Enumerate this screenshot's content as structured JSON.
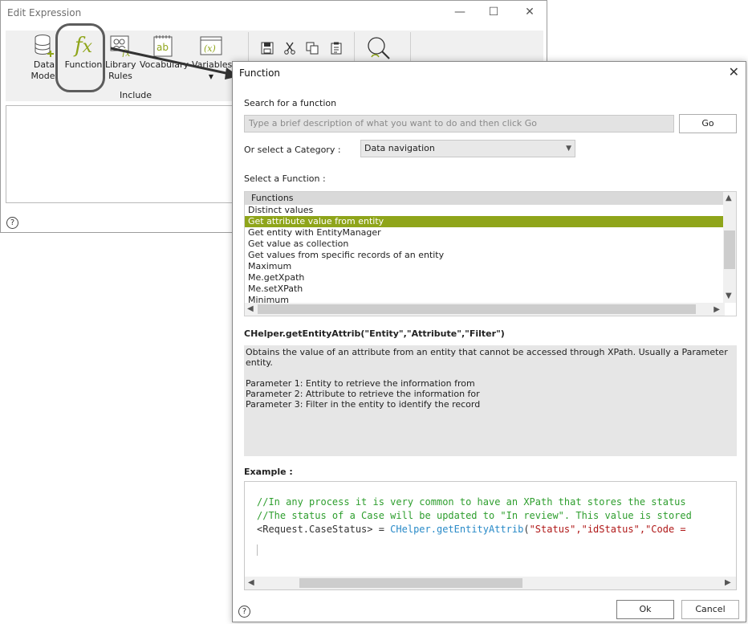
{
  "edit_window": {
    "title": "Edit Expression",
    "ribbon": {
      "buttons": [
        {
          "label": "Data\nModel",
          "icon": "database-add-icon"
        },
        {
          "label": "Function",
          "icon": "function-fx-icon"
        },
        {
          "label": "Library\nRules",
          "icon": "library-rules-icon"
        },
        {
          "label": "Vocabulary",
          "icon": "vocabulary-ab-icon"
        },
        {
          "label": "Variables",
          "icon": "variables-x-icon"
        }
      ],
      "group_label": "Include",
      "tools": [
        "save-icon",
        "cut-icon",
        "copy-icon",
        "paste-icon",
        "find-replace-icon"
      ]
    },
    "help_icon": "?"
  },
  "function_dialog": {
    "title": "Function",
    "close_icon": "✕",
    "search_label": "Search for a function",
    "search_placeholder": "Type a brief description of what you want to do and then click Go",
    "go_label": "Go",
    "category_label": "Or select a Category :",
    "category_value": "Data navigation",
    "function_label": "Select a Function :",
    "list_header": "Functions",
    "functions": [
      "Distinct values",
      "Get attribute value from entity",
      "Get entity with EntityManager",
      "Get value as collection",
      "Get values from specific records of an entity",
      "Maximum",
      "Me.getXpath",
      "Me.setXPath",
      "Minimum"
    ],
    "selected_index": 1,
    "signature": "CHelper.getEntityAttrib(\"Entity\",\"Attribute\",\"Filter\")",
    "description_lines": [
      "Obtains the value of an attribute from an entity that cannot be accessed through XPath. Usually a Parameter entity.",
      "",
      "Parameter 1: Entity to retrieve the information from",
      "Parameter 2: Attribute to retrieve the information for",
      "Parameter 3: Filter in the entity to identify the record"
    ],
    "example_label": "Example :",
    "code": {
      "line1": "//In any process it is very common to have an XPath that stores the status",
      "line2": "//The status of a Case will be updated to \"In review\". This value is stored",
      "line3_a": "<Request.CaseStatus> = ",
      "line3_b": "CHelper.getEntityAttrib",
      "line3_c": "(",
      "line3_d": "\"Status\",\"idStatus\",\"Code = "
    },
    "ok_label": "Ok",
    "cancel_label": "Cancel",
    "help_icon": "?",
    "accent_color": "#8fa51a"
  }
}
